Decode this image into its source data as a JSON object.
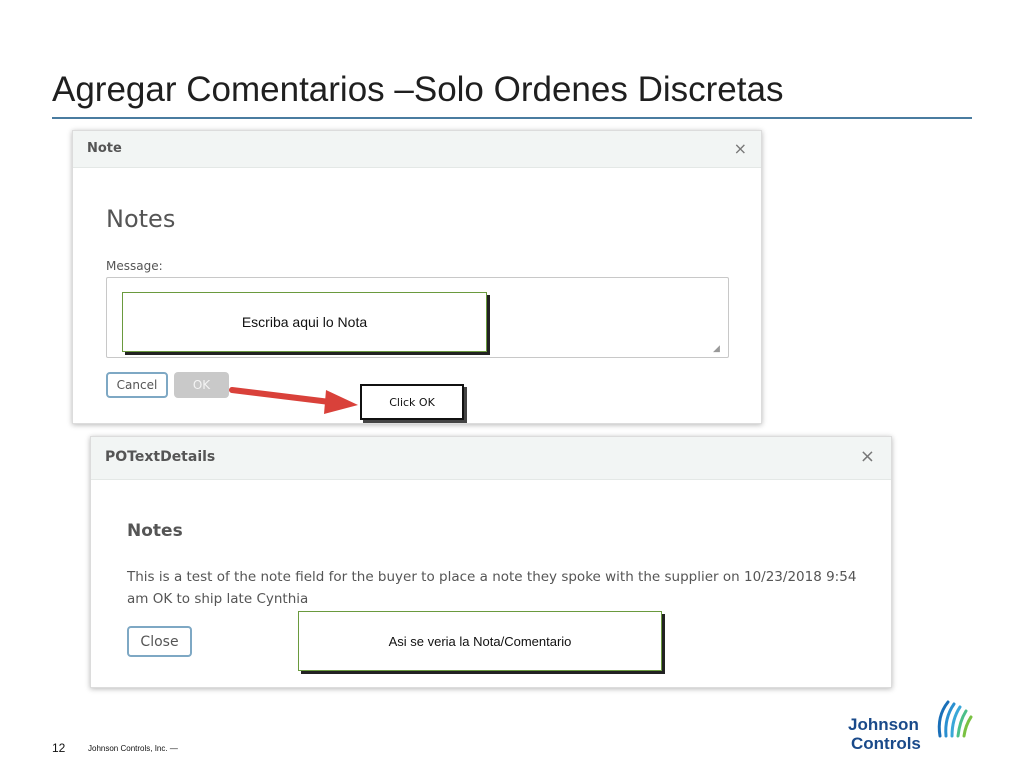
{
  "slide": {
    "title": "Agregar Comentarios –Solo Ordenes Discretas",
    "page_number": "12",
    "footer": "Johnson Controls, Inc. —",
    "logo_line1": "Johnson",
    "logo_line2": "Controls"
  },
  "note_dialog": {
    "header": "Note",
    "close_glyph": "×",
    "heading": "Notes",
    "message_label": "Message:",
    "textarea_value": "",
    "cancel_label": "Cancel",
    "ok_label": "OK"
  },
  "po_dialog": {
    "header": "POTextDetails",
    "close_glyph": "×",
    "heading": "Notes",
    "note_text": "This is a test of the note field for the buyer to place a note they spoke with the supplier on 10/23/2018 9:54 am OK to ship late Cynthia",
    "close_label": "Close"
  },
  "callouts": {
    "write": "Escriba aqui lo Nota",
    "click_ok": "Click OK",
    "view": "Asi se veria la Nota/Comentario"
  },
  "colors": {
    "title_rule": "#4a7ca0",
    "callout_border": "#6a9a3e",
    "arrow": "#d9413a",
    "logo": "#1a4a8a"
  },
  "icons": [
    "close-icon",
    "resize-grip-icon",
    "red-arrow-icon",
    "johnson-controls-logo-icon"
  ]
}
